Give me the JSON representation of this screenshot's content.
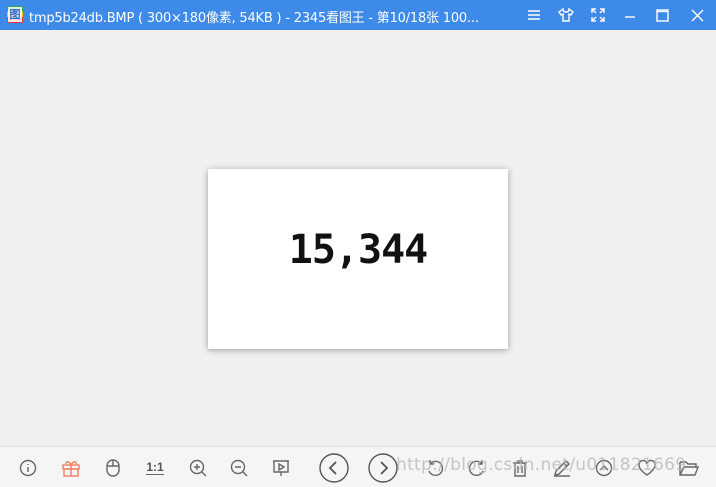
{
  "window": {
    "icon_glyph": "图",
    "title": "tmp5b24db.BMP ( 300×180像素, 54KB ) - 2345看图王 - 第10/18张 100...",
    "controls": [
      "menu-icon",
      "skin-icon",
      "fullscreen-icon",
      "minimize-icon",
      "maximize-icon",
      "close-icon"
    ]
  },
  "image": {
    "content_text": "15,344"
  },
  "toolbar": {
    "ratio_label": "1:1",
    "items": [
      "info-icon",
      "gift-icon",
      "mouse-icon",
      "actual-size-button",
      "zoom-in-icon",
      "zoom-out-icon",
      "slideshow-icon",
      "previous-icon",
      "next-icon",
      "rotate-left-icon",
      "rotate-right-icon",
      "delete-icon",
      "edit-icon",
      "upload-icon",
      "favorite-icon",
      "open-folder-icon"
    ]
  },
  "watermark": "http://blog.csdn.net/u011821669",
  "colors": {
    "titlebar": "#3d8ae8",
    "canvas": "#f0f0f0",
    "gift": "#f0825c"
  }
}
